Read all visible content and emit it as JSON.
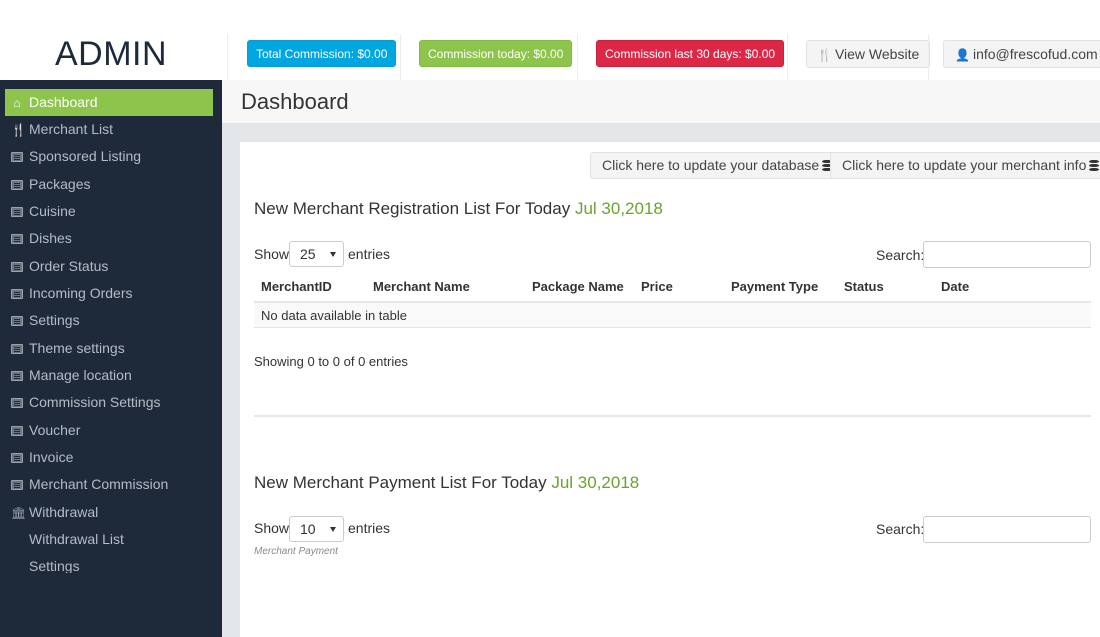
{
  "header": {
    "brand": "ADMIN",
    "badges": {
      "total_commission": "Total Commission: $0.00",
      "commission_today": "Commission today: $0.00",
      "commission_30_days": "Commission last 30 days: $0.00"
    },
    "view_website": "View Website",
    "user_email": "info@frescofud.com"
  },
  "sidebar": {
    "items": [
      {
        "label": "Dashboard",
        "icon": "home-icon",
        "active": true
      },
      {
        "label": "Merchant List",
        "icon": "cutlery-icon"
      },
      {
        "label": "Sponsored Listing",
        "icon": "list-icon"
      },
      {
        "label": "Packages",
        "icon": "list-icon"
      },
      {
        "label": "Cuisine",
        "icon": "list-icon"
      },
      {
        "label": "Dishes",
        "icon": "list-icon"
      },
      {
        "label": "Order Status",
        "icon": "list-icon"
      },
      {
        "label": "Incoming Orders",
        "icon": "list-icon"
      },
      {
        "label": "Settings",
        "icon": "list-icon"
      },
      {
        "label": "Theme settings",
        "icon": "list-icon"
      },
      {
        "label": "Manage location",
        "icon": "list-icon"
      },
      {
        "label": "Commission Settings",
        "icon": "list-icon"
      },
      {
        "label": "Voucher",
        "icon": "list-icon"
      },
      {
        "label": "Invoice",
        "icon": "list-icon"
      },
      {
        "label": "Merchant Commission",
        "icon": "list-icon"
      },
      {
        "label": "Withdrawal",
        "icon": "bank-icon"
      },
      {
        "label": "Withdrawal List",
        "sub": true
      },
      {
        "label": "Settings",
        "sub": true
      }
    ]
  },
  "main": {
    "page_title": "Dashboard",
    "actions": {
      "update_database": "Click here to update your database",
      "update_merchant_info": "Click here to update your merchant info"
    },
    "registration": {
      "title": "New Merchant Registration List For Today",
      "date": "Jul 30,2018",
      "show_label": "Show",
      "page_length": "25",
      "entries_label": "entries",
      "search_label": "Search:",
      "search_value": "",
      "columns": [
        "MerchantID",
        "Merchant Name",
        "Package Name",
        "Price",
        "Payment Type",
        "Status",
        "Date"
      ],
      "empty_message": "No data available in table",
      "info": "Showing 0 to 0 of 0 entries"
    },
    "payment": {
      "title": "New Merchant Payment List For Today",
      "date": "Jul 30,2018",
      "show_label": "Show",
      "page_length": "10",
      "entries_label": "entries",
      "search_label": "Search:",
      "search_value": "",
      "caption": "Merchant Payment"
    }
  }
}
